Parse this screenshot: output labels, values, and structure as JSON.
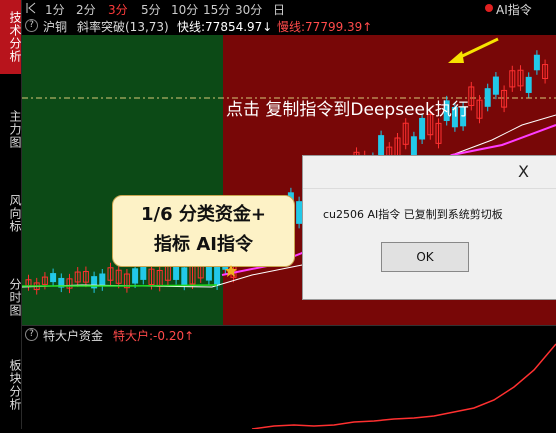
{
  "sidebar": {
    "tabs": [
      {
        "label": "技术分析",
        "active": true
      },
      {
        "label": "主力图",
        "active": false
      },
      {
        "label": "风向标",
        "active": false
      },
      {
        "label": "分时图",
        "active": false
      },
      {
        "label": "板块分析",
        "active": false
      }
    ]
  },
  "topbar": {
    "back_icon": "back-arrow-icon",
    "periods": [
      "1分",
      "2分",
      "3分",
      "5分",
      "10分",
      "15分",
      "30分",
      "日"
    ],
    "active_period": "3分",
    "ai_label": "AI指令"
  },
  "infobar": {
    "help": "?",
    "symbol": "沪铜",
    "indicator": "斜率突破(13,73)",
    "fast_line": "快线:77854.97↓",
    "slow_line": "慢线:77799.39↑"
  },
  "overlay": {
    "instruction": "点击 复制指令到Deepseek执行"
  },
  "callout": {
    "line1": "1/6 分类资金+",
    "line2": "指标 AI指令"
  },
  "dialog": {
    "close": "X",
    "message": "cu2506 AI指令 已复制到系统剪切板",
    "ok": "OK"
  },
  "lower_panel": {
    "help": "?",
    "title": "特大户资金",
    "value": "特大户:-0.20↑"
  },
  "colors": {
    "green_zone": "#0c4a16",
    "red_zone": "#780707",
    "up": "#ff3030",
    "down": "#22c8e8",
    "slow_line": "#ff3cff",
    "fast_line": "#ffffff",
    "ma_green": "#22dd22"
  }
}
